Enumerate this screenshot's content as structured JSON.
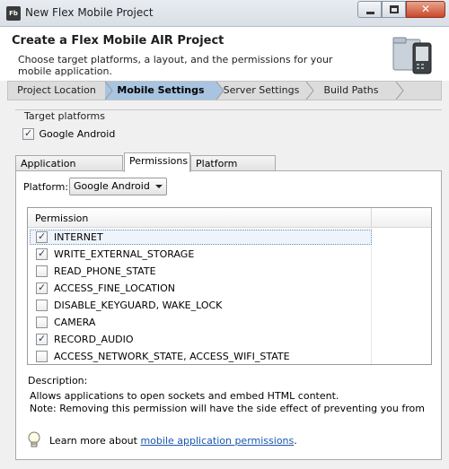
{
  "window": {
    "title": "New Flex Mobile Project",
    "app_icon_text": "Fb",
    "close_glyph": "✕"
  },
  "header": {
    "title": "Create a Flex Mobile AIR Project",
    "description": "Choose target platforms, a layout, and the permissions for your mobile application."
  },
  "steps": [
    {
      "label": "Project Location",
      "active": false
    },
    {
      "label": "Mobile Settings",
      "active": true
    },
    {
      "label": "Server Settings",
      "active": false
    },
    {
      "label": "Build Paths",
      "active": false
    }
  ],
  "target_platforms": {
    "group_label": "Target platforms",
    "options": [
      {
        "label": "Google Android",
        "checked": true
      }
    ]
  },
  "tabs": [
    {
      "label": "Application Template",
      "active": false
    },
    {
      "label": "Permissions",
      "active": true
    },
    {
      "label": "Platform Settings",
      "active": false
    }
  ],
  "permissions_panel": {
    "platform_label": "Platform:",
    "platform_value": "Google Android",
    "column_header": "Permission",
    "rows": [
      {
        "label": "INTERNET",
        "checked": true,
        "selected": true
      },
      {
        "label": "WRITE_EXTERNAL_STORAGE",
        "checked": true,
        "selected": false
      },
      {
        "label": "READ_PHONE_STATE",
        "checked": false,
        "selected": false
      },
      {
        "label": "ACCESS_FINE_LOCATION",
        "checked": true,
        "selected": false
      },
      {
        "label": "DISABLE_KEYGUARD, WAKE_LOCK",
        "checked": false,
        "selected": false
      },
      {
        "label": "CAMERA",
        "checked": false,
        "selected": false
      },
      {
        "label": "RECORD_AUDIO",
        "checked": true,
        "selected": false
      },
      {
        "label": "ACCESS_NETWORK_STATE, ACCESS_WIFI_STATE",
        "checked": false,
        "selected": false
      }
    ],
    "description_label": "Description:",
    "description_line1": "Allows applications to open sockets and embed HTML content.",
    "description_line2": "Note: Removing this permission will have the side effect of preventing you from",
    "hint_prefix": "Learn more about ",
    "hint_link": "mobile application permissions",
    "hint_suffix": "."
  },
  "colors": {
    "active_step": "#a8c4e0",
    "link": "#1a55b0",
    "close_button": "#c9482b"
  }
}
